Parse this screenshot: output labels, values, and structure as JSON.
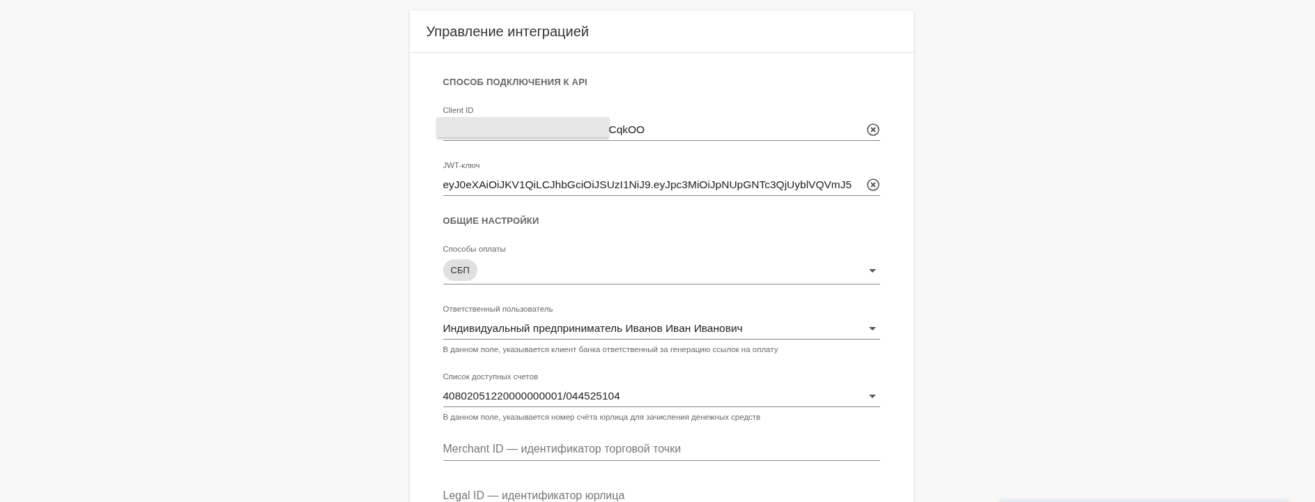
{
  "card": {
    "title": "Управление интеграцией"
  },
  "sections": [
    {
      "title": "СПОСОБ ПОДКЛЮЧЕНИЯ К API",
      "fields": [
        {
          "kind": "text",
          "label": "Client ID",
          "value": "CqkOO",
          "redacted": true
        },
        {
          "kind": "text",
          "label": "JWT-ключ",
          "value": "eyJ0eXAiOiJKV1QiLCJhbGciOiJSUzI1NiJ9.eyJpc3MiOiJpNUpGNTc3QjUyblVQVmJ5"
        }
      ]
    },
    {
      "title": "ОБЩИЕ НАСТРОЙКИ",
      "fields": [
        {
          "kind": "chips",
          "label": "Способы оплаты",
          "chips": [
            "СБП"
          ]
        },
        {
          "kind": "select",
          "label": "Ответственный пользователь",
          "value": "Индивидуальный предприниматель Иванов Иван Иванович",
          "helper": "В данном поле, указывается клиент банка ответственный за генерацию ссылок на оплату"
        },
        {
          "kind": "select",
          "label": "Список доступных счетов",
          "value": "40802051220000000001/044525104",
          "helper": "В данном поле, указывается номер счёта юрлица для зачисления денежных средств"
        },
        {
          "kind": "empty",
          "placeholder": "Merchant ID — идентификатор торговой точки"
        },
        {
          "kind": "empty",
          "placeholder": "Legal ID — идентификатор юрлица"
        }
      ]
    }
  ]
}
